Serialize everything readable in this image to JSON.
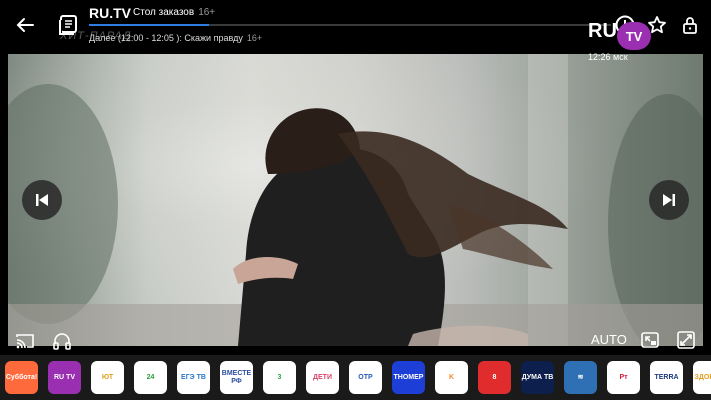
{
  "header": {
    "channel_name": "RU.TV",
    "program_title": "Стол заказов",
    "program_age": "16+",
    "progress": 0.23,
    "next_program": "Далее (12:00 - 12:05 ): Скажи правду",
    "next_age": "16+"
  },
  "video": {
    "logo_ru": "RU",
    "logo_tv": "TV",
    "clock": "12:26 мск",
    "watermark": "ХИТ-ПАРАД"
  },
  "controls": {
    "quality_label": "AUTO"
  },
  "icons": {
    "back": "arrow-left-icon",
    "epg": "tv-guide-icon",
    "report": "alert-circle-icon",
    "favorite": "star-icon",
    "lock": "lock-icon",
    "prev": "skip-previous-icon",
    "next": "skip-next-icon",
    "cast": "cast-icon",
    "audio": "headphones-icon",
    "pip": "picture-in-picture-icon",
    "fullscreen": "fullscreen-icon"
  },
  "channels": [
    {
      "label": "Субботa!",
      "bg": "#ff6a3d",
      "fg": "#ffffff"
    },
    {
      "label": "RU TV",
      "bg": "#9b2fb2",
      "fg": "#ffffff"
    },
    {
      "label": "ЮТ",
      "bg": "#ffffff",
      "fg": "#e0a020"
    },
    {
      "label": "24",
      "bg": "#ffffff",
      "fg": "#2e9d3a"
    },
    {
      "label": "ЕГЭ ТВ",
      "bg": "#ffffff",
      "fg": "#2a79c9"
    },
    {
      "label": "ВМЕСТЕ РФ",
      "bg": "#ffffff",
      "fg": "#2b4fa0"
    },
    {
      "label": "3",
      "bg": "#ffffff",
      "fg": "#2da44e"
    },
    {
      "label": "ДЕТИ",
      "bg": "#ffffff",
      "fg": "#d9446b"
    },
    {
      "label": "ОТР",
      "bg": "#ffffff",
      "fg": "#2a5bb8"
    },
    {
      "label": "ТНОМЕР",
      "bg": "#1d3fd8",
      "fg": "#ffffff"
    },
    {
      "label": "K",
      "bg": "#ffffff",
      "fg": "#f08a24"
    },
    {
      "label": "8",
      "bg": "#e02c2c",
      "fg": "#ffffff"
    },
    {
      "label": "ДУМА ТВ",
      "bg": "#0d1f4d",
      "fg": "#ffffff"
    },
    {
      "label": "≋",
      "bg": "#2f6fb3",
      "fg": "#ffffff"
    },
    {
      "label": "Рт",
      "bg": "#ffffff",
      "fg": "#d21f3c"
    },
    {
      "label": "TERRA",
      "bg": "#ffffff",
      "fg": "#1b3a78"
    },
    {
      "label": "ЗДОРОВ",
      "bg": "#ffffff",
      "fg": "#e0a020"
    }
  ]
}
